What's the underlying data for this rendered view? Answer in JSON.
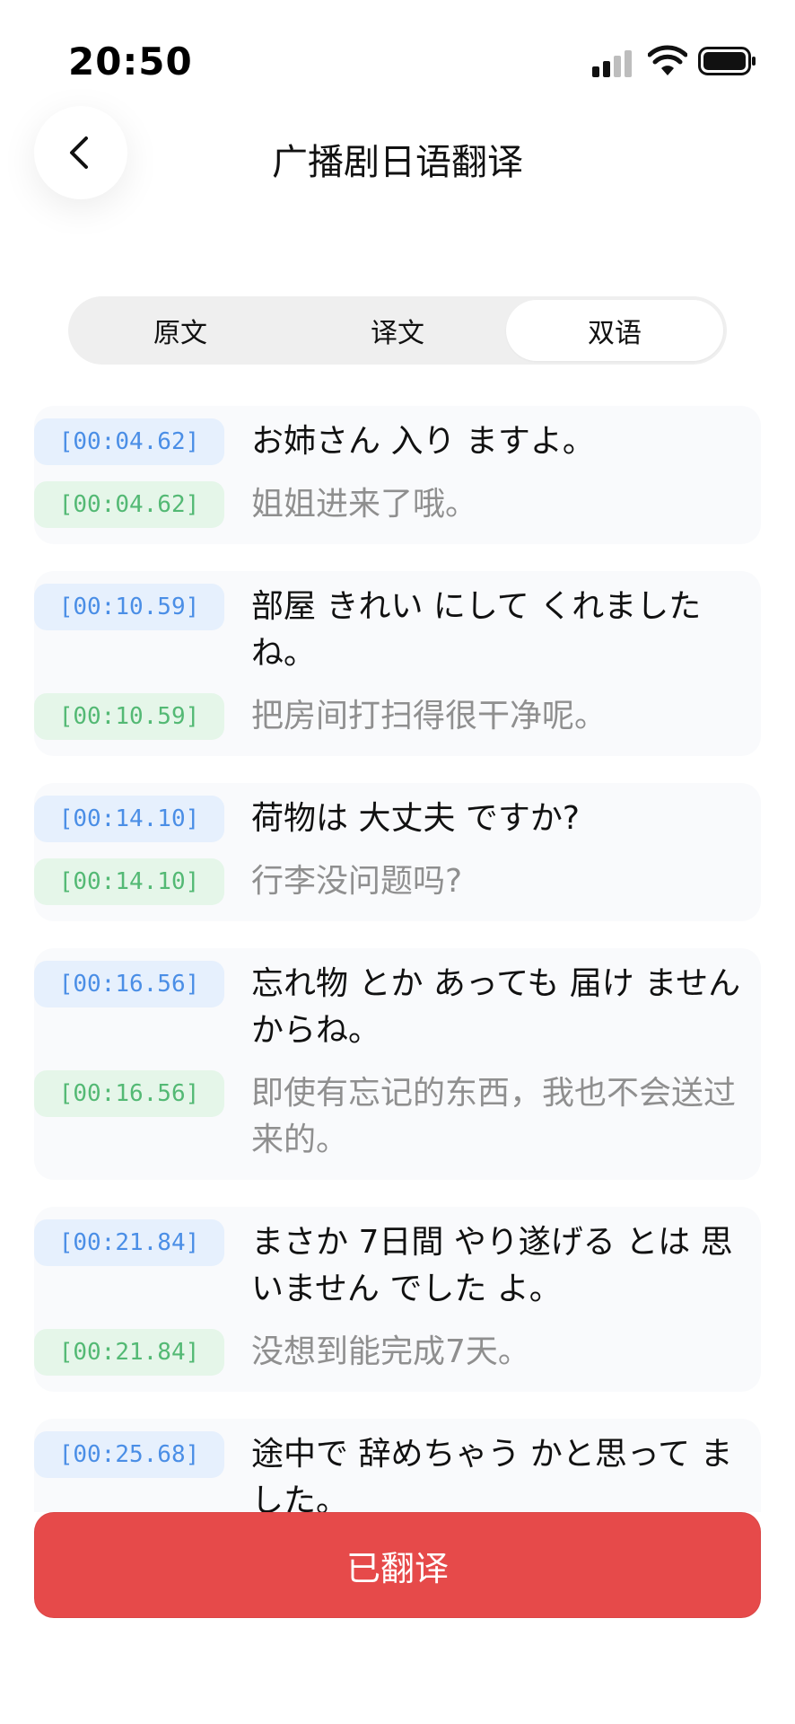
{
  "status": {
    "time": "20:50"
  },
  "header": {
    "title": "广播剧日语翻译"
  },
  "tabs": [
    {
      "label": "原文",
      "active": false
    },
    {
      "label": "译文",
      "active": false
    },
    {
      "label": "双语",
      "active": true
    }
  ],
  "entries": [
    {
      "jp_time": "[00:04.62]",
      "jp": "お姉さん 入り ますよ。",
      "cn_time": "[00:04.62]",
      "cn": "姐姐进来了哦。"
    },
    {
      "jp_time": "[00:10.59]",
      "jp": "部屋 きれい にして くれました ね。",
      "cn_time": "[00:10.59]",
      "cn": "把房间打扫得很干净呢。"
    },
    {
      "jp_time": "[00:14.10]",
      "jp": "荷物は 大丈夫 ですか?",
      "cn_time": "[00:14.10]",
      "cn": "行李没问题吗?"
    },
    {
      "jp_time": "[00:16.56]",
      "jp": "忘れ物 とか あっても 届け ません からね。",
      "cn_time": "[00:16.56]",
      "cn": "即使有忘记的东西，我也不会送过来的。"
    },
    {
      "jp_time": "[00:21.84]",
      "jp": "まさか 7日間 やり遂げる とは 思いません でした よ。",
      "cn_time": "[00:21.84]",
      "cn": "没想到能完成7天。"
    },
    {
      "jp_time": "[00:25.68]",
      "jp": "途中で 辞めちゃう かと思って ました。"
    }
  ],
  "footer": {
    "button_label": "已翻译"
  },
  "colors": {
    "accent_red": "#e64a4a",
    "timestamp_blue": "#4a8ee6",
    "timestamp_green": "#53b974"
  },
  "icons": {
    "back": "chevron-left-icon",
    "signal": "signal-icon",
    "wifi": "wifi-icon",
    "battery": "battery-icon"
  }
}
